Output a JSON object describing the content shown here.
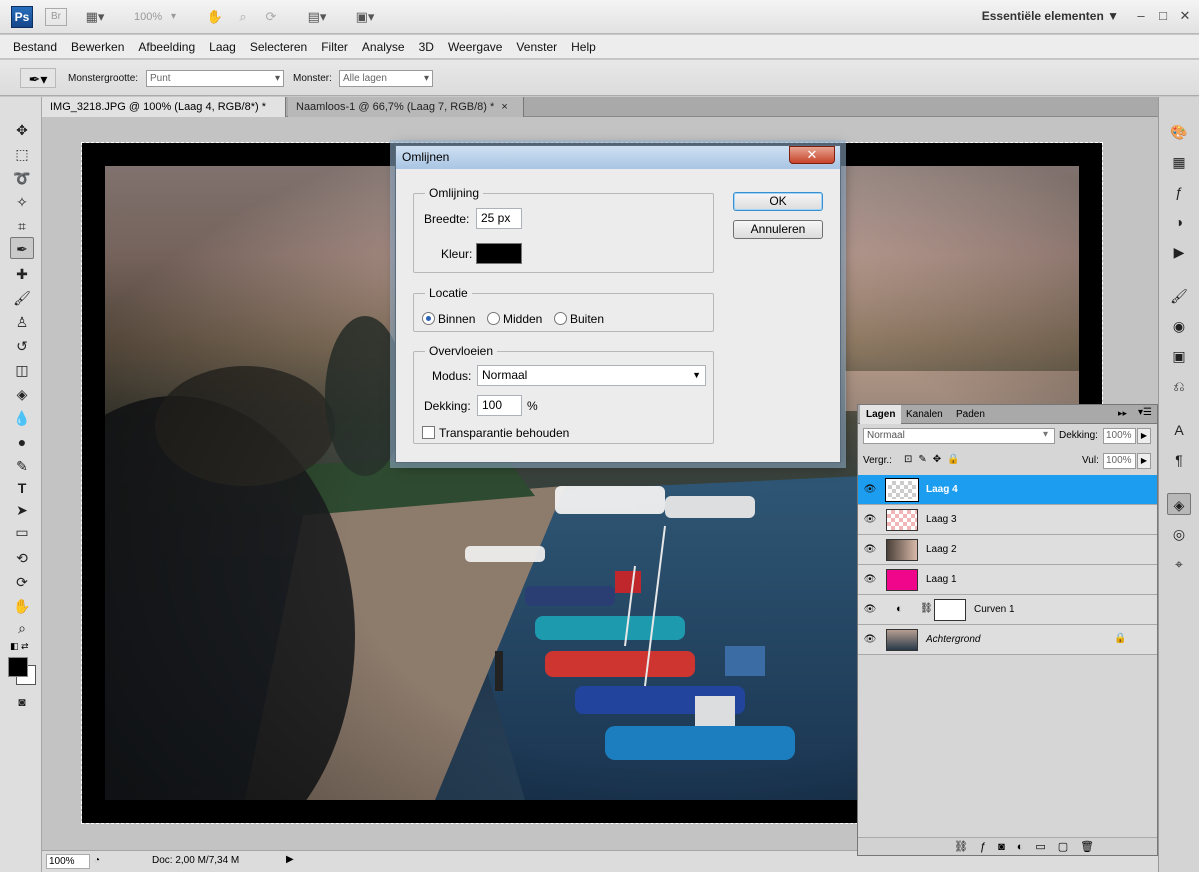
{
  "app": {
    "logo": "Ps",
    "bridge": "Br",
    "zoom": "100%",
    "workspace": "Essentiële elementen ▼"
  },
  "window_controls": {
    "minimize": "–",
    "restore": "□",
    "close": "✕"
  },
  "menu": [
    "Bestand",
    "Bewerken",
    "Afbeelding",
    "Laag",
    "Selecteren",
    "Filter",
    "Analyse",
    "3D",
    "Weergave",
    "Venster",
    "Help"
  ],
  "options": {
    "sample_size_label": "Monstergrootte:",
    "sample_size_value": "Punt",
    "sample_label": "Monster:",
    "sample_value": "Alle lagen"
  },
  "tabs": [
    {
      "label": "IMG_3218.JPG @ 100% (Laag 4, RGB/8*) *",
      "close": "×"
    },
    {
      "label": "Naamloos-1 @ 66,7% (Laag 7, RGB/8) *",
      "close": "×"
    }
  ],
  "status": {
    "zoom": "100%",
    "doc": "Doc: 2,00 M/7,34 M"
  },
  "dialog": {
    "title": "Omlijnen",
    "close": "✕",
    "ok": "OK",
    "cancel": "Annuleren",
    "stroke_group": "Omlijning",
    "width_label": "Breedte:",
    "width_value": "25 px",
    "color_label": "Kleur:",
    "color_value": "#000000",
    "location_group": "Locatie",
    "location_options": [
      "Binnen",
      "Midden",
      "Buiten"
    ],
    "location_selected": "Binnen",
    "blend_group": "Overvloeien",
    "mode_label": "Modus:",
    "mode_value": "Normaal",
    "opacity_label": "Dekking:",
    "opacity_value": "100",
    "opacity_unit": "%",
    "preserve_label": "Transparantie behouden"
  },
  "layers_panel": {
    "tabs": [
      "Lagen",
      "Kanalen",
      "Paden"
    ],
    "blend_mode": "Normaal",
    "opacity_label": "Dekking:",
    "opacity_value": "100%",
    "lock_label": "Vergr.:",
    "fill_label": "Vul:",
    "fill_value": "100%",
    "layers": [
      {
        "name": "Laag 4",
        "selected": true
      },
      {
        "name": "Laag 3",
        "selected": false
      },
      {
        "name": "Laag 2",
        "selected": false
      },
      {
        "name": "Laag 1",
        "selected": false,
        "color": "#f0068a"
      },
      {
        "name": "Curven 1",
        "selected": false
      },
      {
        "name": "Achtergrond",
        "selected": false
      }
    ]
  }
}
